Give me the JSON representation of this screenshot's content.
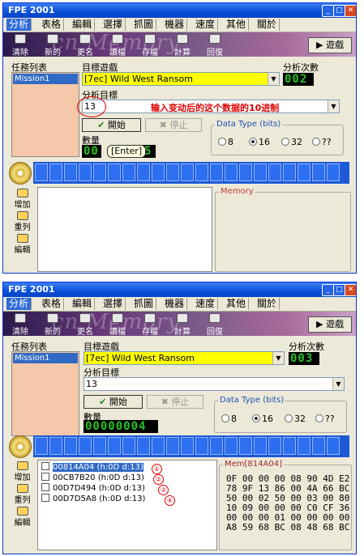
{
  "window1": {
    "title": "FPE 2001",
    "menu": [
      "分析",
      "表格",
      "編輯",
      "選擇",
      "抓圖",
      "機器",
      "速度",
      "其他",
      "關於"
    ],
    "toolbar": {
      "buttons": [
        "清除",
        "新的",
        "更名",
        "讀檔",
        "存檔",
        "計算",
        "回復"
      ],
      "watermark": "cn Memory",
      "game_button": "遊戲"
    },
    "task_list_label": "任務列表",
    "task_list_items": [
      "Mission1"
    ],
    "target_game_label": "目標遊戲",
    "target_game_value": "[7ec] Wild West Ransom",
    "analysis_count_label": "分析次數",
    "analysis_count_value": "002",
    "analysis_target_label": "分析目標",
    "analysis_target_value": "13",
    "annotation": "输入变动后的这个数据的10进制",
    "start_button": "開始",
    "stop_button": "停止",
    "count_label": "數量",
    "count_value": "00",
    "count_suffix": "5",
    "tooltip": "[Enter]",
    "data_type_label": "Data Type (bits)",
    "data_type_options": [
      "8",
      "16",
      "32",
      "??"
    ],
    "data_type_selected": "16",
    "side_buttons": [
      "增加",
      "重列",
      "編輯"
    ],
    "memory_label": "Memory"
  },
  "window2": {
    "title": "FPE 2001",
    "menu": [
      "分析",
      "表格",
      "編輯",
      "選擇",
      "抓圖",
      "機器",
      "速度",
      "其他",
      "關於"
    ],
    "toolbar": {
      "buttons": [
        "清除",
        "新的",
        "更名",
        "讀檔",
        "存檔",
        "計算",
        "回復"
      ],
      "watermark": "cn Memory",
      "game_button": "遊戲"
    },
    "task_list_label": "任務列表",
    "task_list_items": [
      "Mission1"
    ],
    "target_game_label": "目標遊戲",
    "target_game_value": "[7ec] Wild West Ransom",
    "analysis_count_label": "分析次數",
    "analysis_count_value": "003",
    "analysis_target_label": "分析目標",
    "analysis_target_value": "13",
    "start_button": "開始",
    "stop_button": "停止",
    "count_label": "數量",
    "count_value": "00000004",
    "data_type_label": "Data Type (bits)",
    "data_type_options": [
      "8",
      "16",
      "32",
      "??"
    ],
    "data_type_selected": "16",
    "side_buttons": [
      "增加",
      "重列",
      "編輯"
    ],
    "results": [
      {
        "text": "00814A04 (h:0D d:13)",
        "marker": "①"
      },
      {
        "text": "00CB7B20 (h:0D d:13)",
        "marker": "②"
      },
      {
        "text": "00D7D494 (h:0D d:13)",
        "marker": "③"
      },
      {
        "text": "00D7D5A8 (h:0D d:13)",
        "marker": "④"
      }
    ],
    "memory_label": "Mem[814A04]",
    "memory_rows": [
      "0F 00 00 00 08 90 4D E2",
      "78 9F 13 86 00 4A 66 BC",
      "50 00 02 50 00 03 00 80",
      "10 09 00 00 00 C0 CF 36",
      "00 00 00 01 00 00 00 00",
      "A8 59 68 BC 08 48 68 BC"
    ]
  },
  "colors": {
    "title_blue": "#0a4fd6",
    "selection": "#316ac5",
    "lcd_green": "#27c227",
    "annotation_red": "#e00000",
    "game_field_yellow": "#ffff00",
    "task_list_bg": "#f4c8a8"
  }
}
